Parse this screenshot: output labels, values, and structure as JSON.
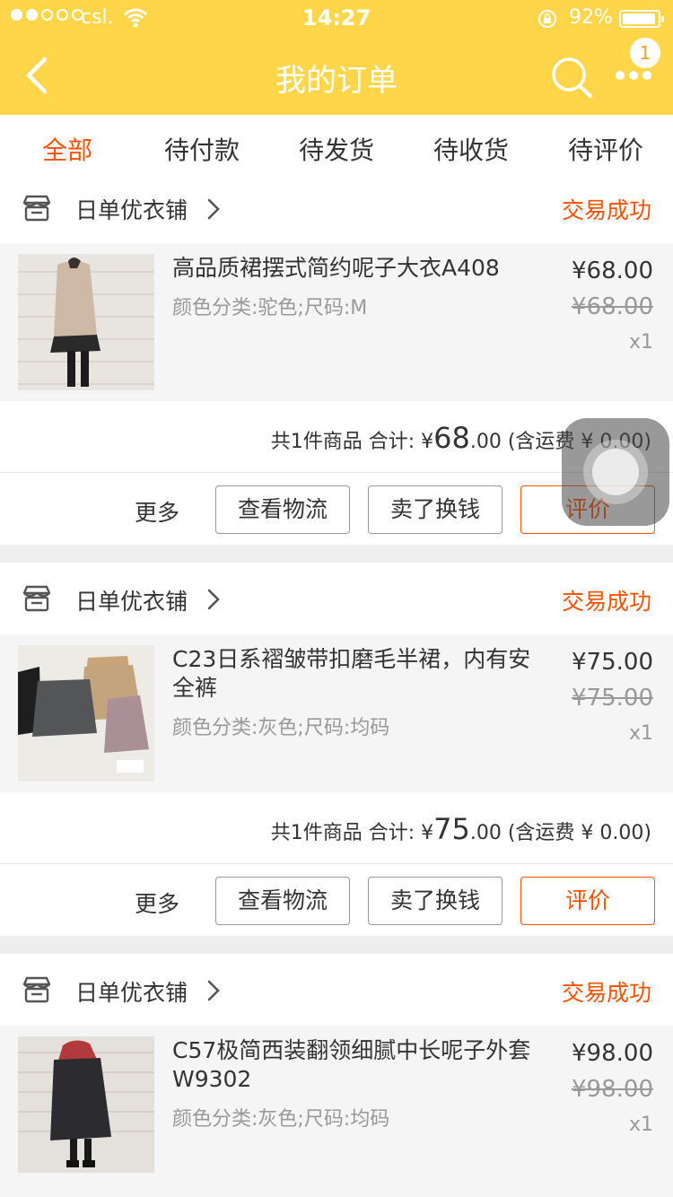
{
  "status_bar": {
    "carrier": "csl.",
    "time": "14:27",
    "battery_pct": "92%"
  },
  "nav": {
    "title": "我的订单",
    "badge": "1"
  },
  "tabs": [
    {
      "label": "全部",
      "active": true
    },
    {
      "label": "待付款"
    },
    {
      "label": "待发货"
    },
    {
      "label": "待收货"
    },
    {
      "label": "待评价"
    }
  ],
  "orders": [
    {
      "shop": "日单优衣铺",
      "status": "交易成功",
      "title": "高品质裙摆式简约呢子大衣A408",
      "sku": "颜色分类:驼色;尺码:M",
      "price": "¥68.00",
      "orig_price": "¥68.00",
      "qty": "x1",
      "summary_prefix": "共1件商品 合计: ¥",
      "total_int": "68",
      "total_dec": ".00",
      "shipping": " (含运费 ¥ 0.00)",
      "more": "更多",
      "btn_logistics": "查看物流",
      "btn_resell": "卖了换钱",
      "btn_review": "评价"
    },
    {
      "shop": "日单优衣铺",
      "status": "交易成功",
      "title": "C23日系褶皱带扣磨毛半裙，内有安全裤",
      "sku": "颜色分类:灰色;尺码:均码",
      "price": "¥75.00",
      "orig_price": "¥75.00",
      "qty": "x1",
      "summary_prefix": "共1件商品 合计: ¥",
      "total_int": "75",
      "total_dec": ".00",
      "shipping": " (含运费 ¥ 0.00)",
      "more": "更多",
      "btn_logistics": "查看物流",
      "btn_resell": "卖了换钱",
      "btn_review": "评价"
    },
    {
      "shop": "日单优衣铺",
      "status": "交易成功",
      "title": "C57极简西装翻领细腻中长呢子外套W9302",
      "sku": "颜色分类:灰色;尺码:均码",
      "price": "¥98.00",
      "orig_price": "¥98.00",
      "qty": "x1"
    }
  ],
  "colors": {
    "brand": "#ffd64a",
    "accent": "#ff5000"
  },
  "icons": [
    "back-arrow-icon",
    "search-icon",
    "more-dots-icon",
    "shop-icon",
    "chevron-right-icon",
    "assistive-touch-icon"
  ]
}
